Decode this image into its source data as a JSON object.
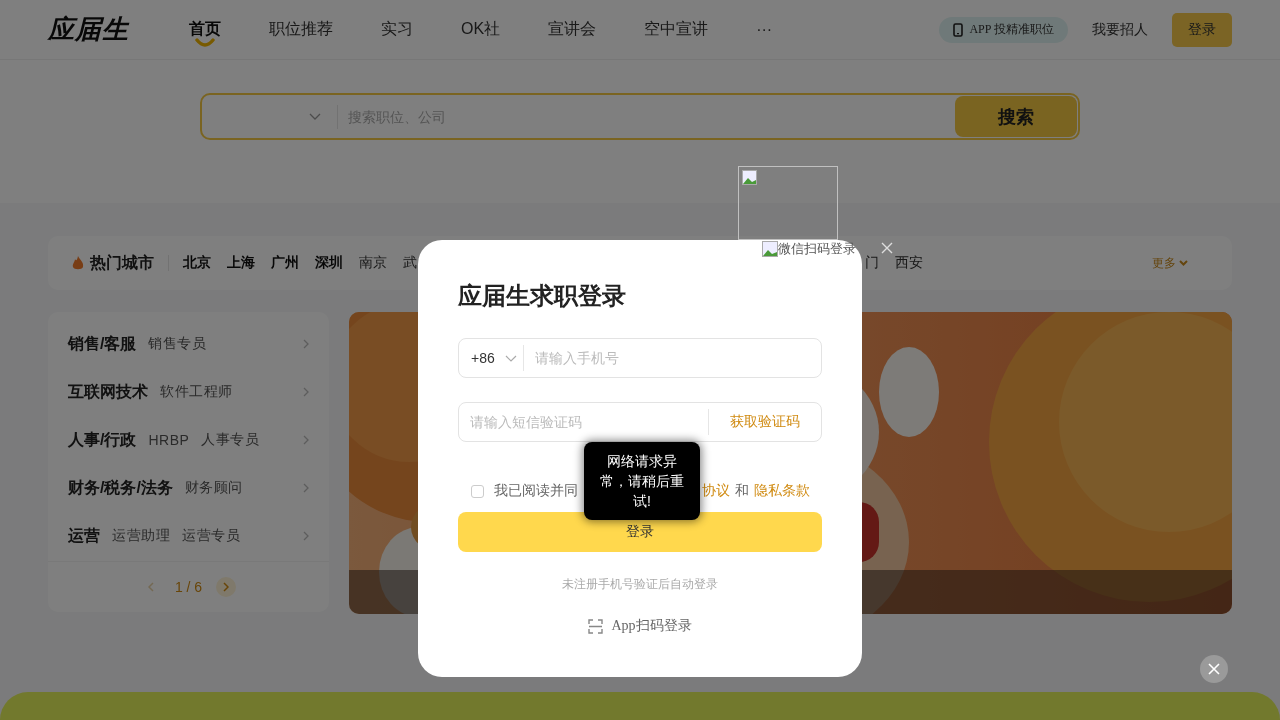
{
  "header": {
    "logo": "应届生",
    "nav": [
      {
        "label": "首页",
        "selected": true
      },
      {
        "label": "职位推荐",
        "selected": false
      },
      {
        "label": "实习",
        "selected": false
      },
      {
        "label": "OK社",
        "selected": false
      },
      {
        "label": "宣讲会",
        "selected": false
      },
      {
        "label": "空中宣讲",
        "selected": false
      },
      {
        "label": "···",
        "selected": false
      }
    ],
    "app_badge": "APP 投精准职位",
    "recruit_link": "我要招人",
    "login_button": "登录"
  },
  "search": {
    "placeholder": "搜索职位、公司",
    "button": "搜索"
  },
  "hot_cities": {
    "title": "热门城市",
    "cities_left": [
      {
        "name": "北京",
        "featured": true
      },
      {
        "name": "上海",
        "featured": true
      },
      {
        "name": "广州",
        "featured": true
      },
      {
        "name": "深圳",
        "featured": true
      },
      {
        "name": "南京",
        "featured": false
      },
      {
        "name": "武",
        "featured": false
      }
    ],
    "cities_right": [
      {
        "name": "门",
        "featured": false
      },
      {
        "name": "西安",
        "featured": false
      }
    ],
    "more": "更多"
  },
  "categories": [
    {
      "name": "销售/客服",
      "jobs": [
        "销售专员"
      ]
    },
    {
      "name": "互联网技术",
      "jobs": [
        "软件工程师"
      ]
    },
    {
      "name": "人事/行政",
      "jobs": [
        "HRBP",
        "人事专员"
      ]
    },
    {
      "name": "财务/税务/法务",
      "jobs": [
        "财务顾问"
      ]
    },
    {
      "name": "运营",
      "jobs": [
        "运营助理",
        "运营专员"
      ]
    }
  ],
  "pager": "1 / 6",
  "login_dialog": {
    "title": "应届生求职登录",
    "country_code": "+86",
    "phone_placeholder": "请输入手机号",
    "code_placeholder": "请输入短信验证码",
    "get_code": "获取验证码",
    "agreement": {
      "checked": false,
      "before": "我已阅读并同",
      "link_1": "协议",
      "joiner": "和",
      "link_2": "隐私条款"
    },
    "login_button": "登录",
    "note": "未注册手机号验证后自动登录",
    "app_scan": "App扫码登录",
    "wechat_alt": "微信扫码登录",
    "toast": "网络请求异常，请稍后重试!"
  }
}
